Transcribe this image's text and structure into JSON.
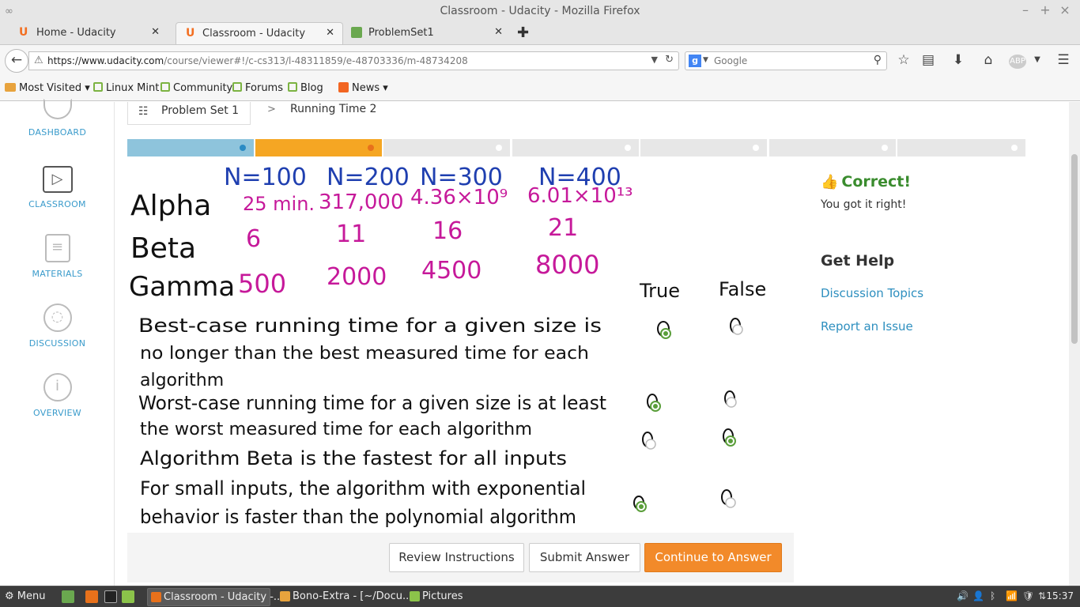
{
  "window": {
    "title": "Classroom - Udacity - Mozilla Firefox"
  },
  "tabs": [
    {
      "label": "Home - Udacity",
      "icon": "U"
    },
    {
      "label": "Classroom - Udacity",
      "icon": "U"
    },
    {
      "label": "ProblemSet1",
      "icon": ""
    }
  ],
  "nav": {
    "url_domain": "https://www.udacity.com",
    "url_path": "/course/viewer#!/c-cs313/l-48311859/e-48703336/m-48734208",
    "search_placeholder": "Google",
    "search_engine_letter": "g"
  },
  "bookmarks": [
    {
      "label": "Most Visited",
      "dropdown": true
    },
    {
      "label": "Linux Mint"
    },
    {
      "label": "Community"
    },
    {
      "label": "Forums"
    },
    {
      "label": "Blog"
    },
    {
      "label": "News",
      "dropdown": true
    }
  ],
  "sidebar": {
    "items": [
      {
        "label": "DASHBOARD",
        "icon": "dashboard-icon"
      },
      {
        "label": "CLASSROOM",
        "icon": "play-icon"
      },
      {
        "label": "MATERIALS",
        "icon": "notebook-icon"
      },
      {
        "label": "DISCUSSION",
        "icon": "chat-bubble-icon"
      },
      {
        "label": "OVERVIEW",
        "icon": "info-icon"
      }
    ]
  },
  "breadcrumb": {
    "lesson": "Problem Set 1",
    "separator": ">",
    "current": "Running Time 2"
  },
  "progress": {
    "segments": [
      {
        "state": "visited",
        "color": "#8ec4dc",
        "dot": "#2a8bc4"
      },
      {
        "state": "current",
        "color": "#f5a623",
        "dot": "#e8711b"
      },
      {
        "state": "todo"
      },
      {
        "state": "todo"
      },
      {
        "state": "todo"
      },
      {
        "state": "todo"
      },
      {
        "state": "todo"
      }
    ]
  },
  "whiteboard": {
    "headers": [
      "N=100",
      "N=200",
      "N=300",
      "N=400"
    ],
    "rows": [
      {
        "name": "Alpha",
        "values": [
          "25 min.",
          "317,000",
          "4.36×10⁹",
          "6.01×10¹³"
        ]
      },
      {
        "name": "Beta",
        "values": [
          "6",
          "11",
          "16",
          "21"
        ]
      },
      {
        "name": "Gamma",
        "values": [
          "500",
          "2000",
          "4500",
          "8000"
        ]
      }
    ],
    "answer_headers": [
      "True",
      "False"
    ],
    "statements": [
      {
        "line1": "Best-case running time for a given size is",
        "line2": "no longer than the best measured time for each",
        "line3": "algorithm",
        "selected": "true"
      },
      {
        "line1": "Worst-case running time for a given size is at least",
        "line2": "the worst measured time for each algorithm",
        "line3": "",
        "selected": "true"
      },
      {
        "line1": "Algorithm Beta is the fastest for all inputs",
        "line2": "",
        "line3": "",
        "selected": "false"
      },
      {
        "line1": "For small inputs, the algorithm with exponential",
        "line2": "behavior is faster than the polynomial algorithm",
        "line3": "",
        "selected": "true"
      }
    ]
  },
  "feedback": {
    "title": "Correct!",
    "message": "You got it right!"
  },
  "help": {
    "title": "Get Help",
    "links": [
      "Discussion Topics",
      "Report an Issue"
    ]
  },
  "buttons": {
    "review": "Review Instructions",
    "submit": "Submit Answer",
    "continue": "Continue to Answer"
  },
  "taskbar": {
    "menu": "Menu",
    "tasks": [
      {
        "label": "Classroom - Udacity -...",
        "active": true
      },
      {
        "label": "Bono-Extra - [~/Docu...",
        "active": false
      },
      {
        "label": "Pictures",
        "active": false
      }
    ],
    "clock": "15:37"
  },
  "colors": {
    "correct": "#3a8c2e",
    "link": "#2e8fbf",
    "primary_button": "#f28a2a",
    "hw_blue": "#1f3fb0",
    "hw_red": "#c0182a",
    "hw_magenta": "#c6199a"
  }
}
